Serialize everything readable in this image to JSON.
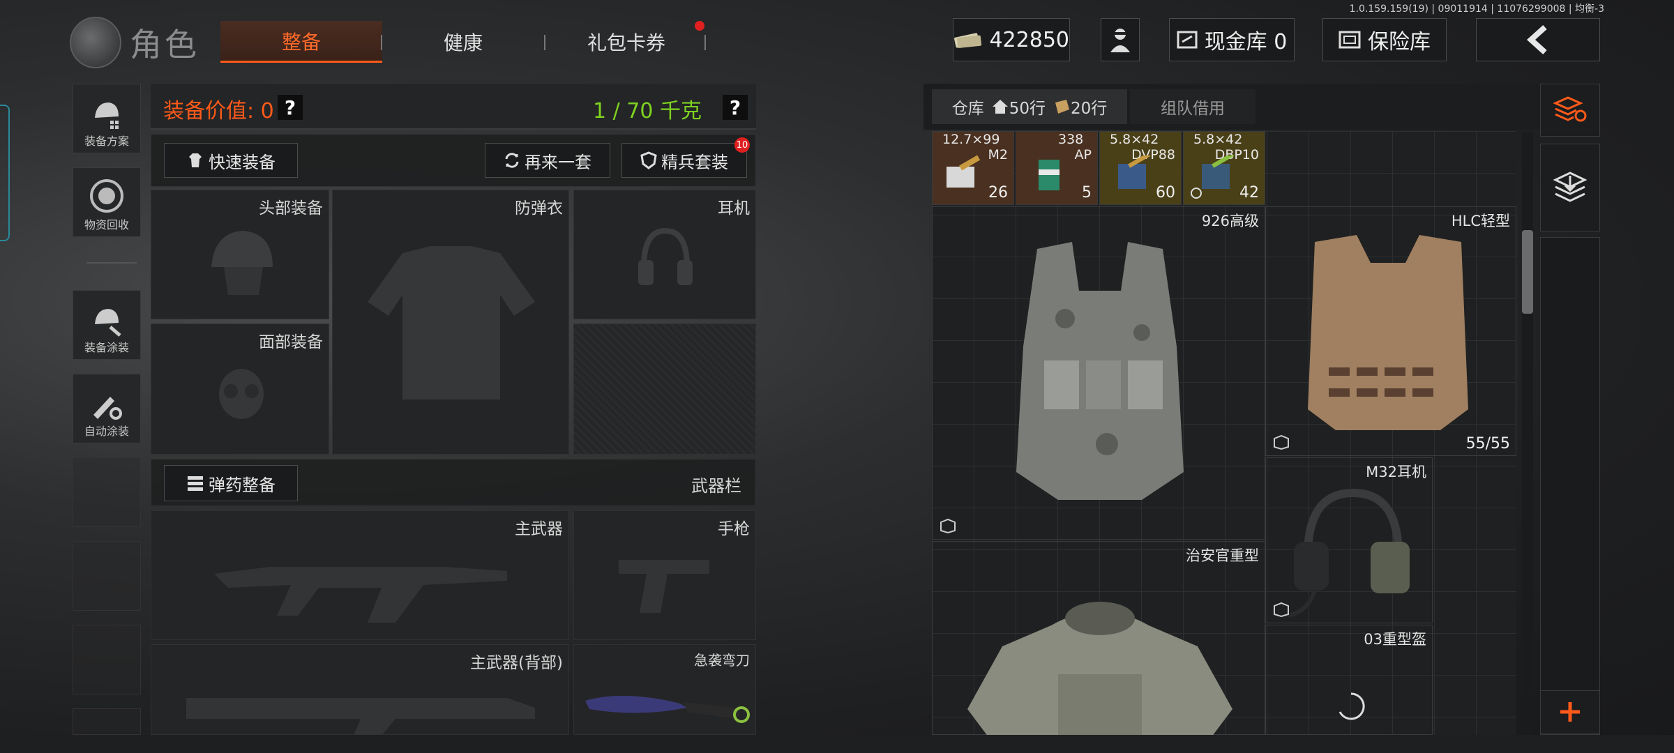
{
  "version": "1.0.159.159(19) | 09011914 | 11076299008 | 均衡-3",
  "header": {
    "title": "角色",
    "tabs": [
      {
        "label": "整备",
        "active": true
      },
      {
        "label": "健康",
        "active": false
      },
      {
        "label": "礼包卡券",
        "active": false,
        "badge": true
      }
    ],
    "money": "422850",
    "cash_vault": "现金库 0",
    "safe_vault": "保险库"
  },
  "sidebar": [
    {
      "label": "装备方案"
    },
    {
      "label": "物资回收"
    },
    {
      "label": "装备涂装"
    },
    {
      "label": "自动涂装"
    }
  ],
  "equipment": {
    "value_label": "装备价值: 0",
    "weight": "1 / 70 千克",
    "quick_equip": "快速装备",
    "again": "再来一套",
    "elite": "精兵套装",
    "elite_badge": "10",
    "slots": {
      "head": "头部装备",
      "armor": "防弹衣",
      "ear": "耳机",
      "face": "面部装备",
      "primary": "主武器",
      "pistol": "手枪",
      "primary_back": "主武器(背部)",
      "melee": "急袭弯刀"
    },
    "ammo_btn": "弹药整备",
    "weapon_bar": "武器栏"
  },
  "warehouse": {
    "tab": "仓库",
    "rows1": "50行",
    "rows2": "20行",
    "team": "组队借用",
    "ammo": [
      {
        "name": "12.7×99",
        "sub": "M2",
        "count": "26",
        "color": "#5a3a22"
      },
      {
        "name": "338",
        "sub": "AP",
        "count": "5",
        "color": "#5a3a22"
      },
      {
        "name": "5.8×42",
        "sub": "DVP88",
        "count": "60",
        "color": "#5a4a1a"
      },
      {
        "name": "5.8×42",
        "sub": "DBP10",
        "count": "42",
        "color": "#5a4a1a"
      }
    ],
    "items": {
      "vest_926": "926高级",
      "hlc": "HLC轻型",
      "hlc_dur": "55/55",
      "m32": "M32耳机",
      "police": "治安官重型",
      "helmet03": "03重型盔"
    }
  },
  "colors": {
    "accent": "#ff5a1a",
    "green": "#7ed321"
  }
}
